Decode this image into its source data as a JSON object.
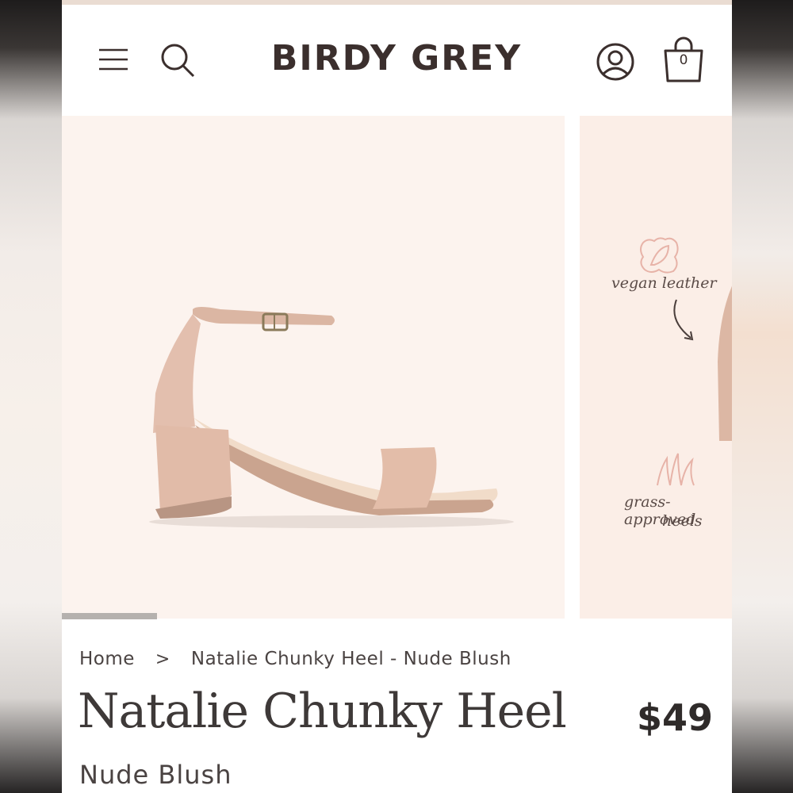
{
  "header": {
    "logo": "BIRDY GREY",
    "cart_count": "0",
    "icons": [
      "menu-icon",
      "search-icon",
      "account-icon",
      "shopping-bag-icon"
    ]
  },
  "gallery": {
    "slides": [
      {
        "image": "nude blush block-heel ankle-strap sandal"
      },
      {
        "features": [
          "vegan leather",
          "grass-approved",
          "heels"
        ]
      }
    ],
    "progress": 0.19
  },
  "breadcrumb": {
    "home": "Home",
    "separator": ">",
    "current": "Natalie Chunky Heel - Nude Blush"
  },
  "product": {
    "name": "Natalie Chunky Heel",
    "price": "$49",
    "color": "Nude Blush"
  },
  "colors": {
    "brand_text": "#3b2f2d",
    "image_bg": "#fcf3ee",
    "accent_pink": "#e7b3a8"
  }
}
